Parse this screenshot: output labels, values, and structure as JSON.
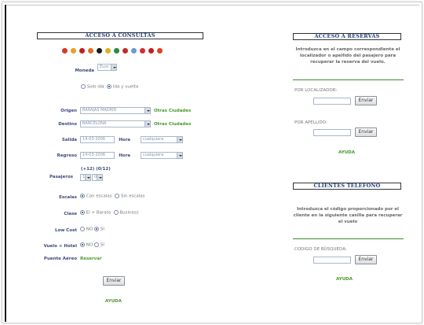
{
  "consultas": {
    "title": "ACCESO A CONSULTAS",
    "moneda_label": "Moneda",
    "moneda_value": "Euro",
    "trip_options": [
      "Solo ida",
      "Ida y vuelta"
    ],
    "trip_selected": "Ida y vuelta",
    "origen_label": "Origen",
    "origen_value": "BARAJAS MADRID",
    "otras_ciudades": "Otras Ciudades",
    "destino_label": "Destino",
    "destino_value": "BARCELONA",
    "salida_label": "Salida",
    "salida_value": "14-03-2006",
    "hora_label": "Hora",
    "hora_value": "cualquiera",
    "regreso_label": "Regreso",
    "regreso_value": "14-03-2006",
    "pasajeros_label": "Pasajeros",
    "pasajeros_hint": "(+12) (0/12)",
    "pasajeros_adult": "1",
    "pasajeros_child": "0",
    "escalas_label": "Escalas",
    "escalas_options": [
      "Con escalas",
      "Sin escalas"
    ],
    "clase_label": "Clase",
    "clase_options": [
      "El + Barato",
      "Business"
    ],
    "lowcost_label": "Low Cost",
    "lowcost_options": [
      "NO",
      "SI"
    ],
    "vuelohotel_label": "Vuelo + Hotel",
    "vuelohotel_options": [
      "NO",
      "SI"
    ],
    "puente_label": "Puente Aéreo",
    "puente_link": "Reservar",
    "enviar": "Enviar",
    "ayuda": "AYUDA"
  },
  "reservas": {
    "title": "ACCESO A RESERVAS",
    "intro": "Introduzca en el campo correspondiente el localizador o apellido del pasajero para recuperar la reserva del vuelo.",
    "localizador_label": "POR LOCALIZADOR:",
    "apellido_label": "POR APELLIDO:",
    "enviar": "Enviar",
    "ayuda": "AYUDA"
  },
  "clientes": {
    "title": "CLIENTES TELEFONO",
    "intro": "Introduzca el código proporcionado por el cliente en la siguiente casilla para recuperar el vuelo",
    "codigo_label": "CODIGO DE BÚSQUEDA:",
    "enviar": "Enviar",
    "ayuda": "AYUDA"
  },
  "colors": {
    "title_text": "#1f3f7a",
    "link_green": "#4a9a2a",
    "label_blue": "#3a4a7a"
  },
  "flag_colors": [
    "#d23a2a",
    "#e8a020",
    "#c02020",
    "#e07020",
    "#1a1a1a",
    "#e0b020",
    "#2a8a3a",
    "#c02a2a",
    "#6a9ad0",
    "#d03030",
    "#c02020",
    "#e04020"
  ]
}
